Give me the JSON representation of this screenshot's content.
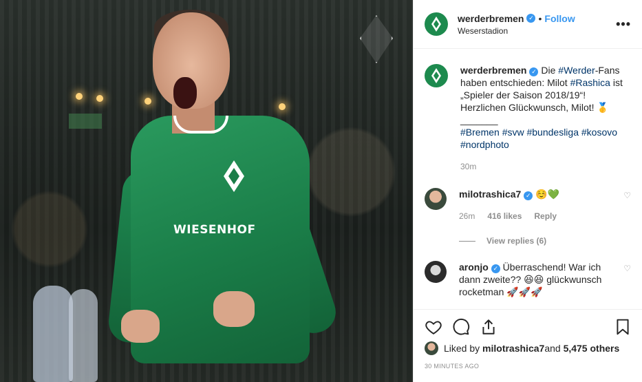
{
  "post": {
    "author": "werderbremen",
    "follow_label": "Follow",
    "location": "Weserstadion",
    "more_label": "•••",
    "sponsor_text": "WIESENHOF",
    "caption": {
      "user": "werderbremen",
      "text_1": "Die ",
      "tag_werder": "#Werder",
      "text_2": "-Fans haben entschieden: Milot ",
      "tag_rashica": "#Rashica",
      "text_3": " ist „Spieler der Saison 2018/19“! Herzlichen Glückwunsch, Milot! 🥇",
      "separator": "_______",
      "hashtags": "#Bremen #svw #bundesliga #kosovo #nordphoto",
      "time": "30m"
    },
    "comments": [
      {
        "user": "milotrashica7",
        "text": "☺️💚",
        "time": "26m",
        "likes": "416 likes",
        "reply_label": "Reply",
        "view_replies": "View replies (6)"
      },
      {
        "user": "aronjo",
        "text": "Überraschend! War ich dann zweite?? 😆😆 glückwunsch rocketman 🚀🚀🚀"
      }
    ],
    "liked_by_prefix": "Liked by ",
    "liked_by_user": "milotrashica7",
    "liked_by_suffix": " and ",
    "liked_by_count": "5,475 others",
    "posted_ago": "30 MINUTES AGO"
  }
}
